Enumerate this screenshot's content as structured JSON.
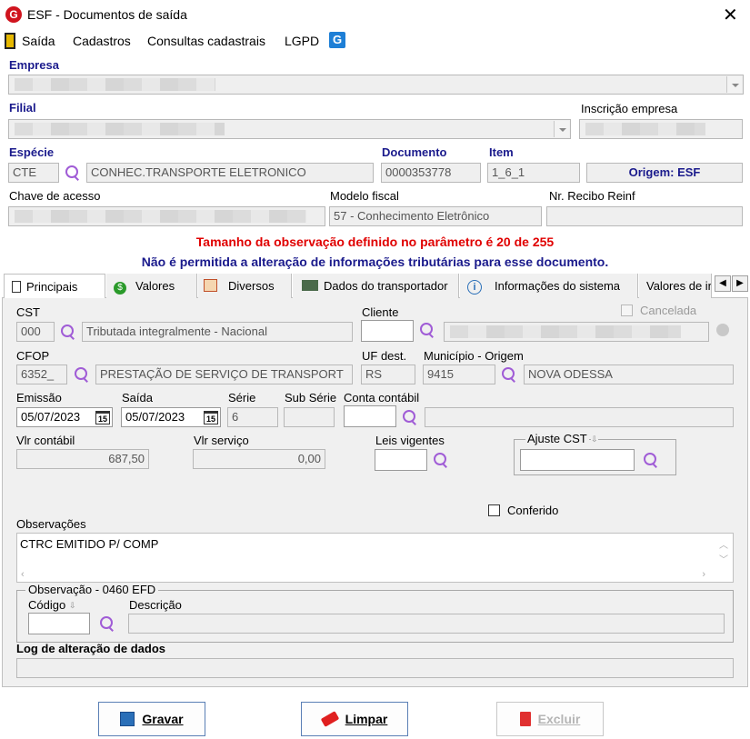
{
  "window": {
    "title": "ESF - Documentos de saída"
  },
  "menu": {
    "items": [
      "Saída",
      "Cadastros",
      "Consultas cadastrais",
      "LGPD"
    ]
  },
  "header": {
    "empresa_label": "Empresa",
    "filial_label": "Filial",
    "inscricao_label": "Inscrição empresa",
    "especie_label": "Espécie",
    "especie_code": "CTE",
    "especie_desc": "CONHEC.TRANSPORTE ELETRONICO",
    "documento_label": "Documento",
    "documento_value": "0000353778",
    "item_label": "Item",
    "item_value": "1_6_1",
    "origem": "Origem: ESF",
    "chave_label": "Chave de acesso",
    "modelo_label": "Modelo fiscal",
    "modelo_value": "57 - Conhecimento Eletrônico",
    "recibo_label": "Nr. Recibo Reinf",
    "warning_red": "Tamanho da observação definido no parâmetro é 20 de 255",
    "warning_blue": "Não é permitida a alteração de informações tributárias para esse documento."
  },
  "tabs": [
    "Principais",
    "Valores",
    "Diversos",
    "Dados do transportador",
    "Informações do sistema",
    "Valores de ir"
  ],
  "main": {
    "cst_label": "CST",
    "cst_code": "000",
    "cst_desc": "Tributada integralmente - Nacional",
    "cliente_label": "Cliente",
    "cancelada_label": "Cancelada",
    "cfop_label": "CFOP",
    "cfop_code": "6352_",
    "cfop_desc": "PRESTAÇÃO DE SERVIÇO DE TRANSPORT",
    "uf_label": "UF dest.",
    "uf_value": "RS",
    "municipio_label": "Município - Origem",
    "municipio_code": "9415",
    "municipio_desc": "NOVA ODESSA",
    "emissao_label": "Emissão",
    "emissao_value": "05/07/2023",
    "saida_label": "Saída",
    "saida_value": "05/07/2023",
    "serie_label": "Série",
    "serie_value": "6",
    "subserie_label": "Sub Série",
    "conta_label": "Conta contábil",
    "vlr_contabil_label": "Vlr contábil",
    "vlr_contabil_value": "687,50",
    "vlr_servico_label": "Vlr serviço",
    "vlr_servico_value": "0,00",
    "leis_label": "Leis vigentes",
    "ajuste_label": "Ajuste CST",
    "conferido_label": "Conferido",
    "obs_label": "Observações",
    "obs_value": "CTRC EMITIDO P/ COMP",
    "obs_efd_label": "Observação - 0460 EFD",
    "codigo_label": "Código",
    "descricao_label": "Descrição",
    "log_label": "Log de alteração de dados"
  },
  "buttons": {
    "gravar": "Gravar",
    "limpar": "Limpar",
    "excluir": "Excluir"
  },
  "colors": {
    "label_blue": "#1a1a8c",
    "warning_red": "#e00000",
    "warning_blue": "#1a1a8c"
  }
}
